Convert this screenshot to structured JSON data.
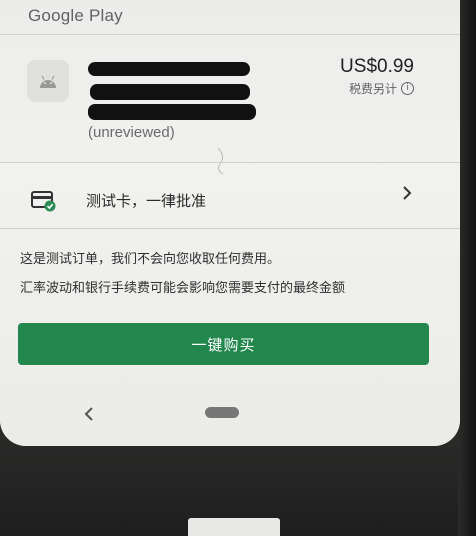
{
  "header": {
    "store_name": "Google Play"
  },
  "product": {
    "icon_name": "android-icon",
    "review_status": "(unreviewed)",
    "price": "US$0.99",
    "tax_note": "税费另计",
    "tax_info_icon": "info-icon"
  },
  "payment": {
    "method_icon": "credit-card-check-icon",
    "method_label": "测试卡，一律批准",
    "chevron_icon": "chevron-right-icon"
  },
  "notes": {
    "test_order": "这是测试订单，我们不会向您收取任何费用。",
    "exchange_rate": "汇率波动和银行手续费可能会影响您需要支付的最终金额"
  },
  "actions": {
    "buy_label": "一键购买"
  },
  "colors": {
    "accent_green": "#21874d",
    "check_badge": "#2e8b57"
  },
  "system_nav": {
    "back_icon": "back-chevron-icon",
    "home_handle": "home-pill"
  }
}
